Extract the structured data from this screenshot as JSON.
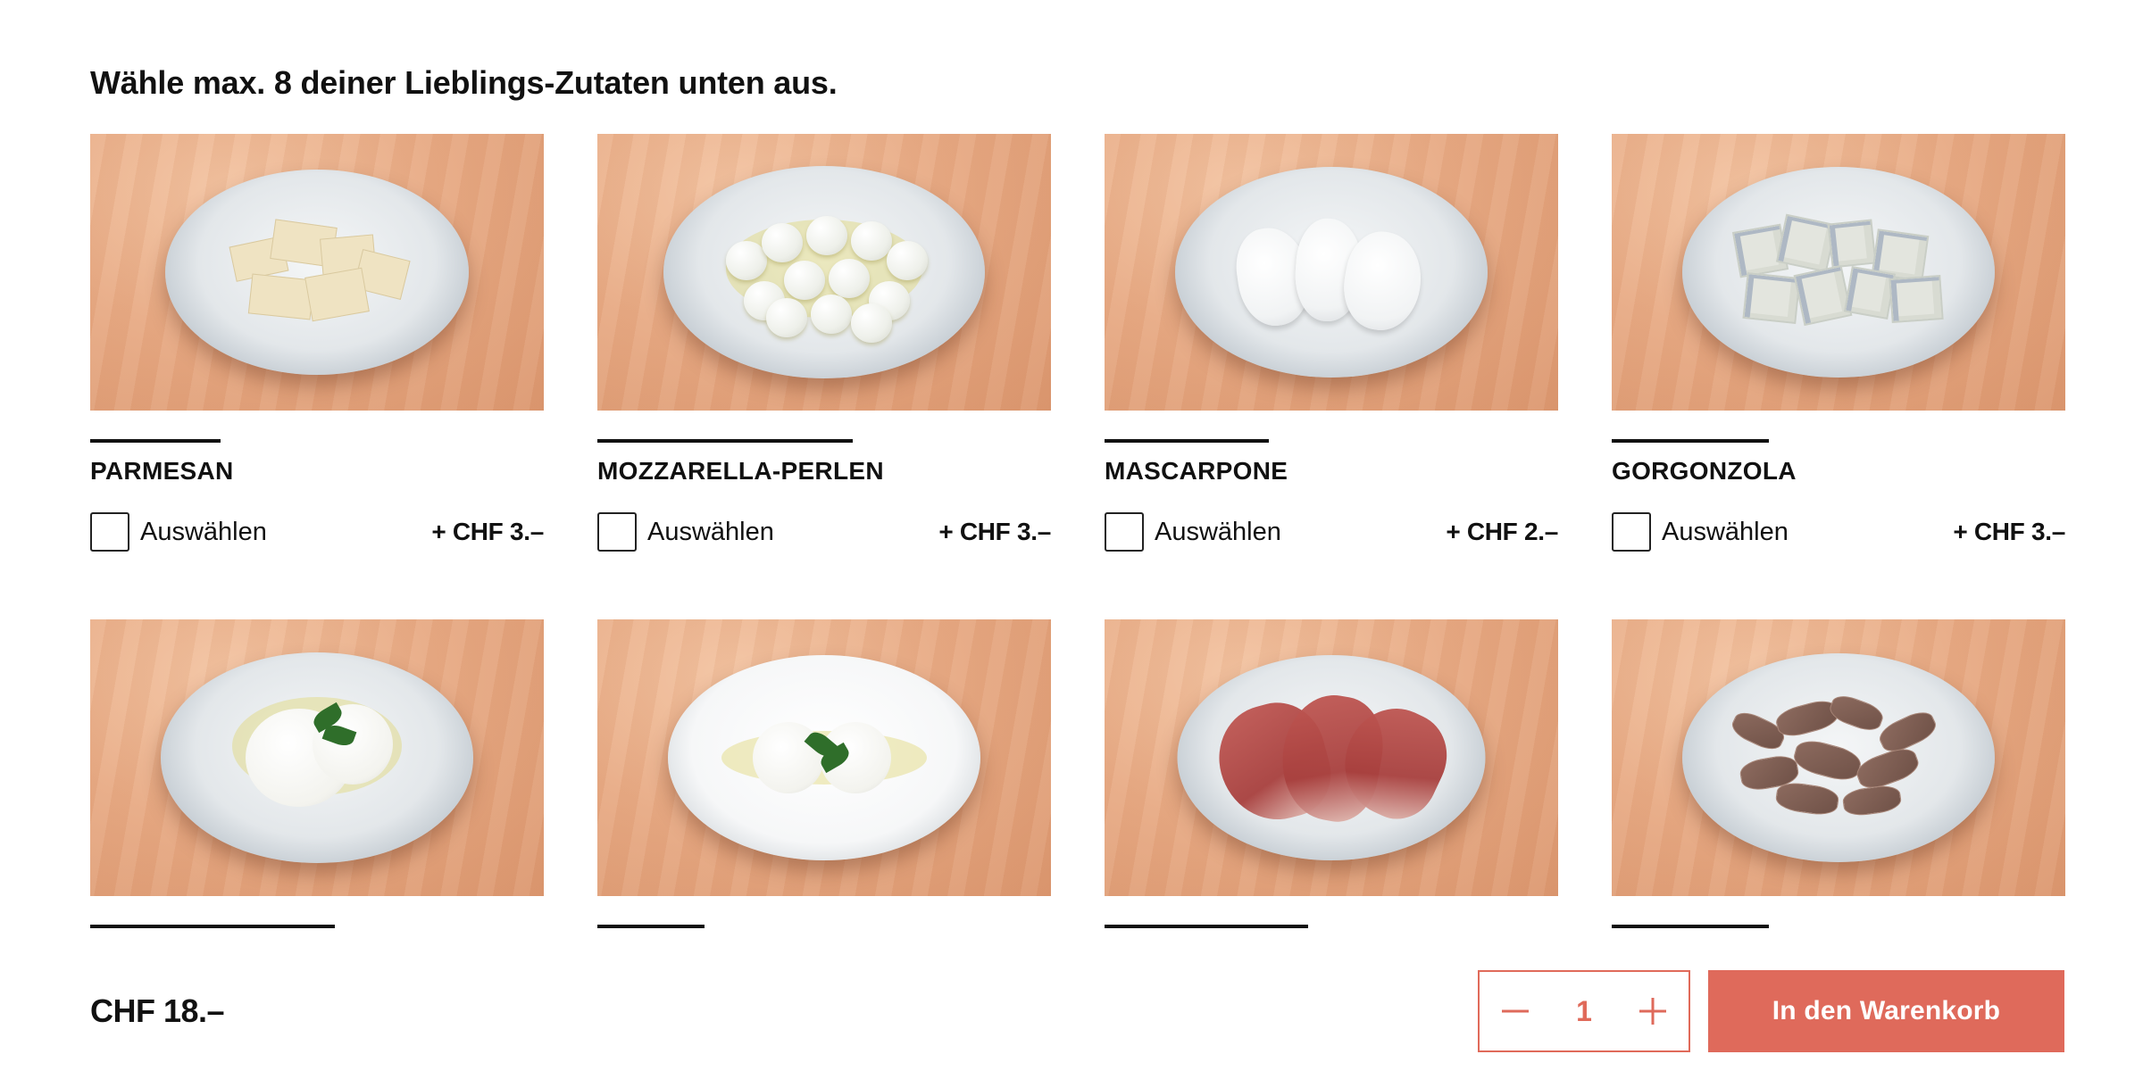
{
  "heading": "Wähle max. 8 deiner Lieblings-Zutaten unten aus.",
  "ingredients": [
    {
      "name": "PARMESAN",
      "select_label": "Auswählen",
      "price": "+ CHF 3.–",
      "image": "parmesan-plate"
    },
    {
      "name": "MOZZARELLA-PERLEN",
      "select_label": "Auswählen",
      "price": "+ CHF 3.–",
      "image": "mozzarella-pearls-plate"
    },
    {
      "name": "MASCARPONE",
      "select_label": "Auswählen",
      "price": "+ CHF 2.–",
      "image": "mascarpone-plate"
    },
    {
      "name": "GORGONZOLA",
      "select_label": "Auswählen",
      "price": "+ CHF 3.–",
      "image": "gorgonzola-plate"
    },
    {
      "image": "buffalo-mozzarella-plate"
    },
    {
      "image": "burrata-plate"
    },
    {
      "image": "prosciutto-plate"
    },
    {
      "image": "veal-plate"
    }
  ],
  "footer": {
    "total": "CHF 18.–",
    "quantity": "1",
    "cart_button": "In den Warenkorb"
  },
  "colors": {
    "accent": "#df6a5b",
    "text": "#111111"
  },
  "icons": {
    "decrement": "minus-icon",
    "increment": "plus-icon"
  }
}
